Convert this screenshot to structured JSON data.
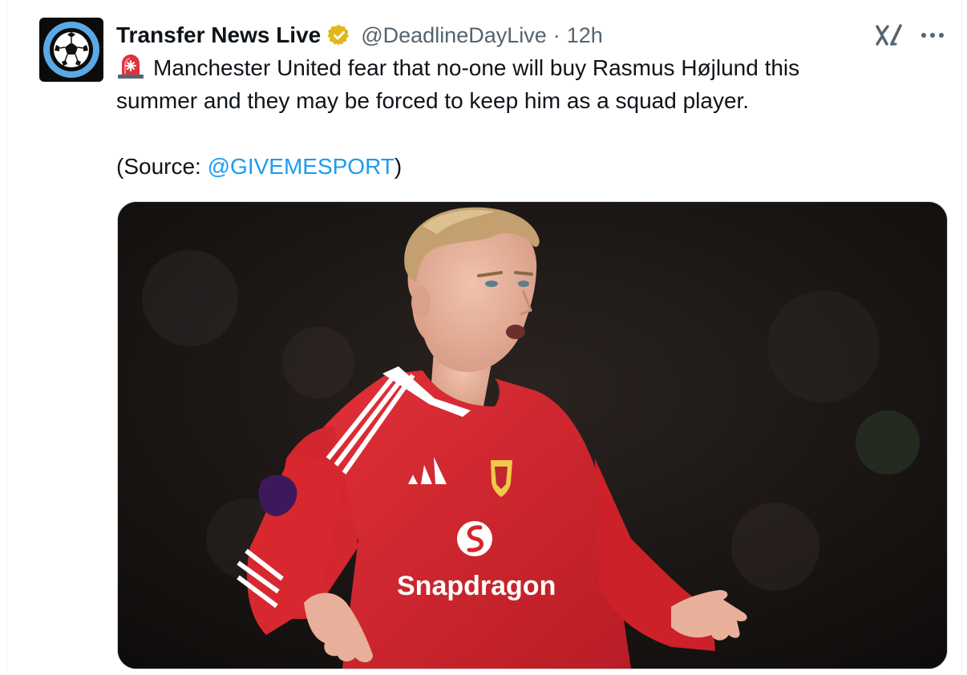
{
  "author": {
    "display_name": "Transfer News Live",
    "handle": "@DeadlineDayLive",
    "separator": "·",
    "time_ago": "12h",
    "avatar_icon": "soccer-ball-icon",
    "verified_icon": "verified-badge-icon",
    "verified_color": "#e2b719"
  },
  "actions": {
    "grok_icon": "grok-icon",
    "more_icon": "more-options-icon",
    "more_glyph": "···"
  },
  "body": {
    "emoji_icon": "police-siren-icon",
    "line1": "Manchester United fear that no-one will buy Rasmus Højlund this",
    "line2": "summer and they may be forced to keep him as a squad player.",
    "source_open": "(Source: ",
    "source_mention": "@GIVEMESPORT",
    "source_close": ")"
  },
  "media": {
    "type": "photo",
    "subject_icon": "footballer-photo",
    "shirt_sponsor": "Snapdragon",
    "shirt_color": "#d8242c"
  },
  "colors": {
    "link": "#1d9bf0",
    "secondary_text": "#536471",
    "border": "#cfd9de"
  }
}
